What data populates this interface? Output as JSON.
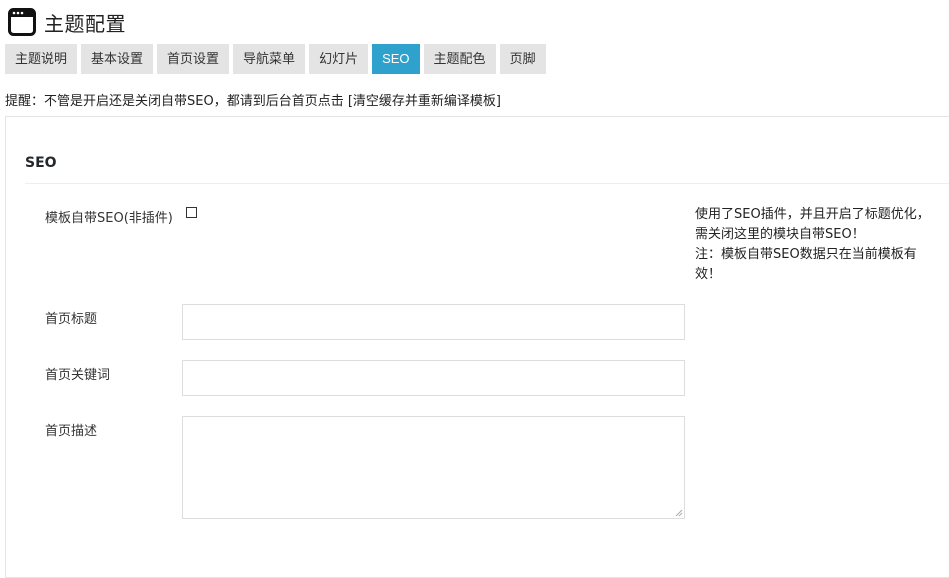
{
  "header": {
    "title": "主题配置",
    "icon": "browser-window-icon"
  },
  "tabs": [
    {
      "label": "主题说明",
      "active": false
    },
    {
      "label": "基本设置",
      "active": false
    },
    {
      "label": "首页设置",
      "active": false
    },
    {
      "label": "导航菜单",
      "active": false
    },
    {
      "label": "幻灯片",
      "active": false
    },
    {
      "label": "SEO",
      "active": true
    },
    {
      "label": "主题配色",
      "active": false
    },
    {
      "label": "页脚",
      "active": false
    }
  ],
  "reminder": "提醒：不管是开启还是关闭自带SEO，都请到后台首页点击 [清空缓存并重新编译模板]",
  "section": {
    "title": "SEO",
    "seo_toggle_label": "模板自带SEO(非插件)",
    "seo_toggle_checked": false,
    "help_lines": [
      "使用了SEO插件，并且开启了标题优化，",
      "需关闭这里的模块自带SEO！",
      "注：模板自带SEO数据只在当前模板有",
      "效！"
    ],
    "fields": {
      "home_title": {
        "label": "首页标题",
        "value": ""
      },
      "home_keywords": {
        "label": "首页关键词",
        "value": ""
      },
      "home_description": {
        "label": "首页描述",
        "value": ""
      }
    }
  },
  "colors": {
    "accent": "#2ea2cc",
    "tab_bg": "#e4e4e4",
    "border": "#dddddd"
  }
}
